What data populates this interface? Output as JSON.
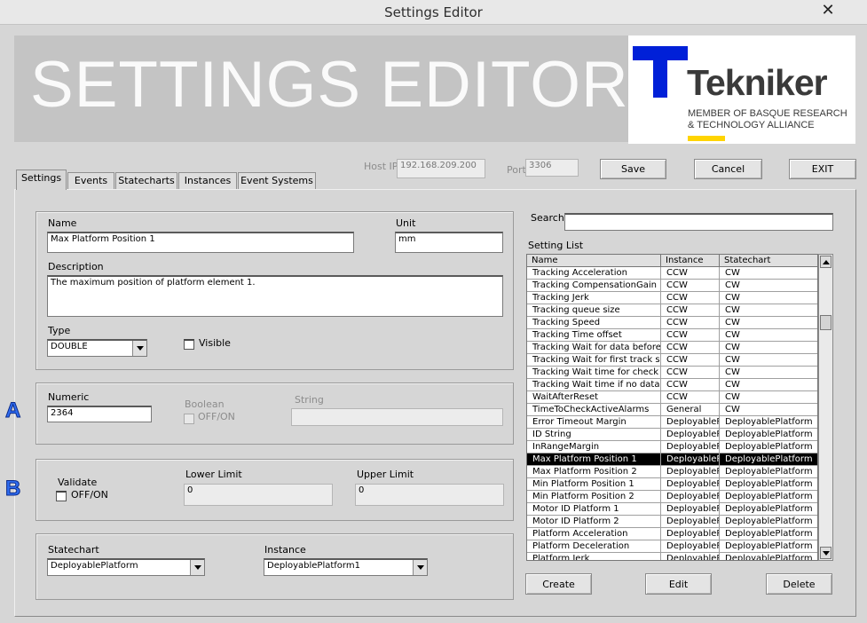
{
  "window": {
    "title": "Settings Editor",
    "close_glyph": "✕"
  },
  "banner": {
    "title": "SETTINGS EDITOR"
  },
  "logo": {
    "name": "Tekniker",
    "line1": "MEMBER OF BASQUE RESEARCH",
    "line2": "& TECHNOLOGY ALLIANCE",
    "colors": {
      "mark": "#0020d8",
      "underline": "#ffd400"
    }
  },
  "connection": {
    "host_label": "Host IP",
    "host_value": "192.168.209.200",
    "port_label": "Port",
    "port_value": "3306"
  },
  "toolbar": {
    "save": "Save",
    "cancel": "Cancel",
    "exit": "EXIT"
  },
  "tabs": [
    "Settings",
    "Events",
    "Statecharts",
    "Instances",
    "Event Systems"
  ],
  "active_tab": "Settings",
  "form": {
    "name_label": "Name",
    "name_value": "Max Platform Position 1",
    "unit_label": "Unit",
    "unit_value": "mm",
    "description_label": "Description",
    "description_value": "The maximum position of platform element 1.",
    "type_label": "Type",
    "type_value": "DOUBLE",
    "visible_label": "Visible"
  },
  "value_panel": {
    "numeric_label": "Numeric",
    "numeric_value": "2364",
    "boolean_label": "Boolean",
    "boolean_option": "OFF/ON",
    "string_label": "String",
    "string_value": ""
  },
  "validation": {
    "validate_label": "Validate",
    "validate_option": "OFF/ON",
    "lower_label": "Lower Limit",
    "lower_value": "0",
    "upper_label": "Upper Limit",
    "upper_value": "0"
  },
  "assignment": {
    "statechart_label": "Statechart",
    "statechart_value": "DeployablePlatform",
    "instance_label": "Instance",
    "instance_value": "DeployablePlatform1"
  },
  "markers": {
    "a": "A",
    "b": "B"
  },
  "search": {
    "label": "Search:",
    "value": ""
  },
  "setting_list": {
    "label": "Setting List",
    "columns": [
      "Name",
      "Instance",
      "Statechart"
    ],
    "rows": [
      [
        "Tracking Acceleration",
        "CCW",
        "CW"
      ],
      [
        "Tracking CompensationGain",
        "CCW",
        "CW"
      ],
      [
        "Tracking Jerk",
        "CCW",
        "CW"
      ],
      [
        "Tracking queue size",
        "CCW",
        "CW"
      ],
      [
        "Tracking Speed",
        "CCW",
        "CW"
      ],
      [
        "Tracking Time offset",
        "CCW",
        "CW"
      ],
      [
        "Tracking Wait for data before e",
        "CCW",
        "CW"
      ],
      [
        "Tracking Wait for first track setp",
        "CCW",
        "CW"
      ],
      [
        "Tracking Wait time for check se",
        "CCW",
        "CW"
      ],
      [
        "Tracking Wait time if no data in",
        "CCW",
        "CW"
      ],
      [
        "WaitAfterReset",
        "CCW",
        "CW"
      ],
      [
        "TimeToCheckActiveAlarms",
        "General",
        "CW"
      ],
      [
        "Error Timeout Margin",
        "DeployableP",
        "DeployablePlatform"
      ],
      [
        "ID String",
        "DeployableP",
        "DeployablePlatform"
      ],
      [
        "InRangeMargin",
        "DeployableP",
        "DeployablePlatform"
      ],
      [
        "Max Platform Position 1",
        "DeployableP",
        "DeployablePlatform"
      ],
      [
        "Max Platform Position 2",
        "DeployableP",
        "DeployablePlatform"
      ],
      [
        "Min Platform Position 1",
        "DeployableP",
        "DeployablePlatform"
      ],
      [
        "Min Platform Position 2",
        "DeployableP",
        "DeployablePlatform"
      ],
      [
        "Motor ID Platform 1",
        "DeployableP",
        "DeployablePlatform"
      ],
      [
        "Motor ID Platform 2",
        "DeployableP",
        "DeployablePlatform"
      ],
      [
        "Platform Acceleration",
        "DeployableP",
        "DeployablePlatform"
      ],
      [
        "Platform Deceleration",
        "DeployableP",
        "DeployablePlatform"
      ],
      [
        "Platform Jerk",
        "DeployableP",
        "DeployablePlatform"
      ]
    ],
    "selected_index": 15
  },
  "list_actions": {
    "create": "Create",
    "edit": "Edit",
    "delete": "Delete"
  }
}
